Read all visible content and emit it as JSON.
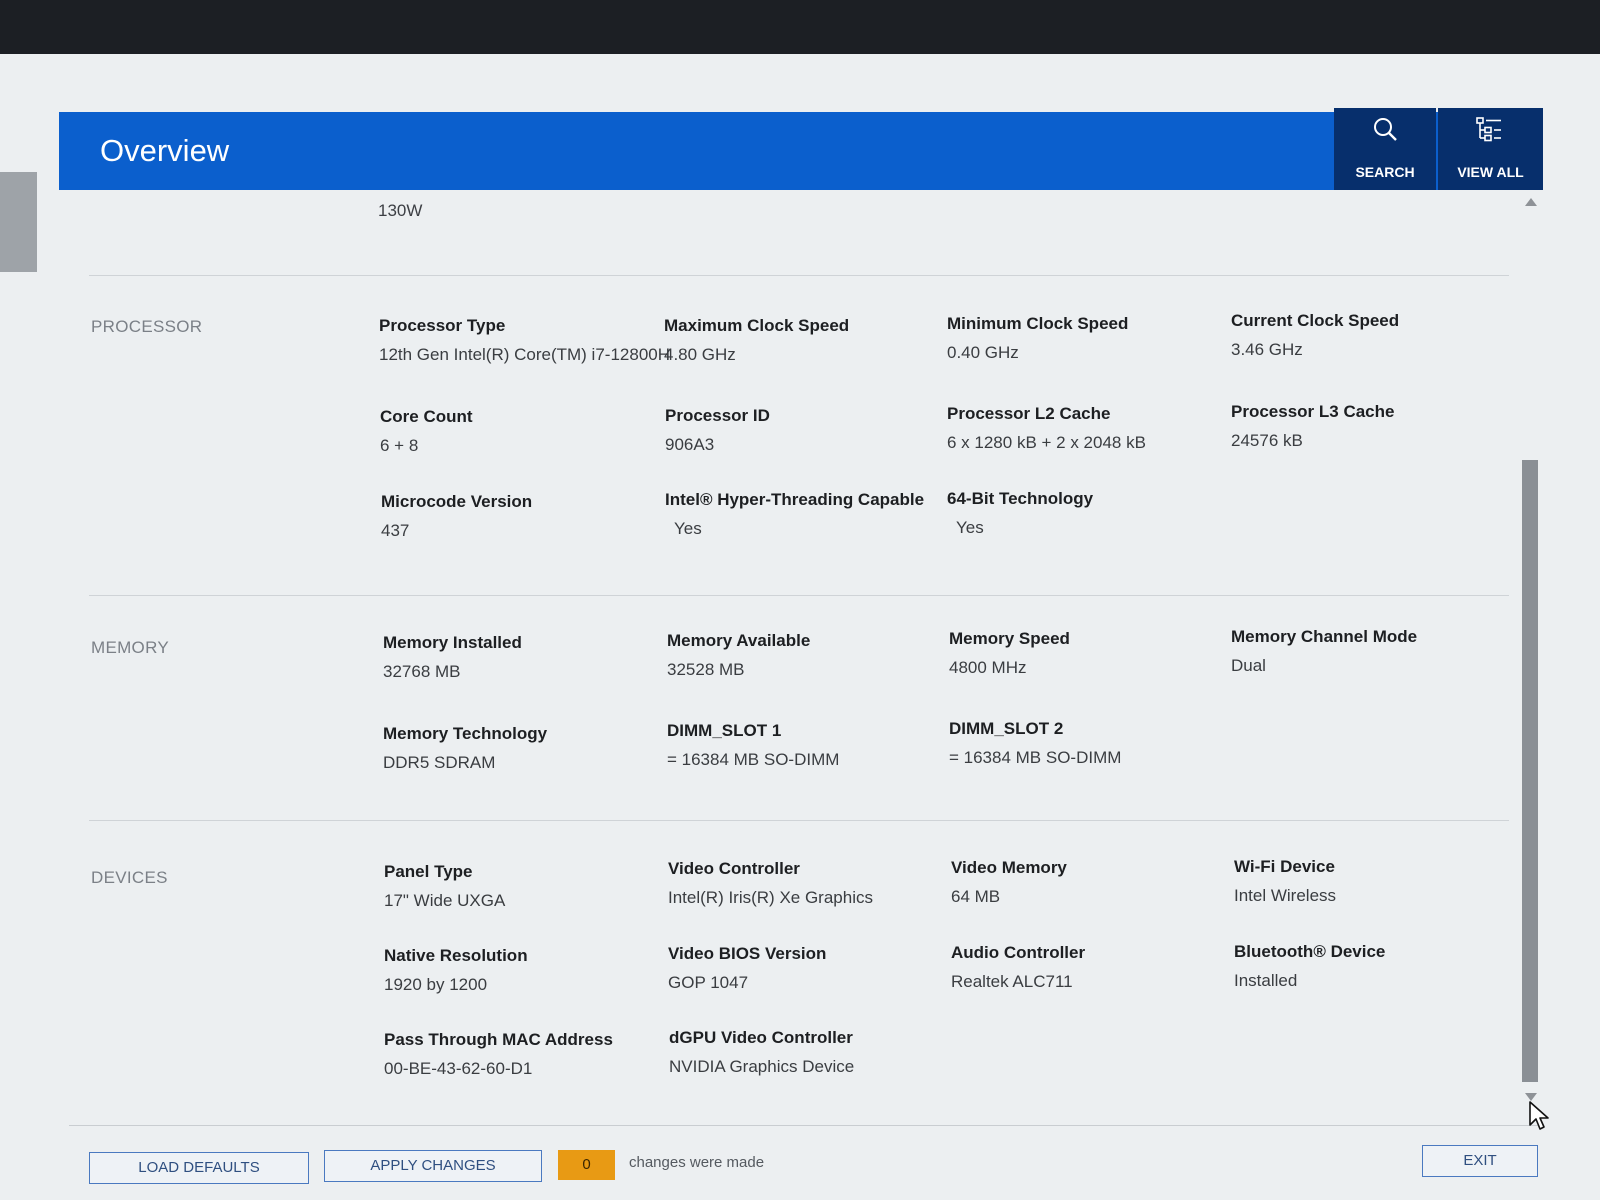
{
  "header": {
    "title": "Overview",
    "search_label": "SEARCH",
    "view_all_label": "VIEW ALL",
    "search_icon": "search-icon",
    "view_all_icon": "tree-list-icon"
  },
  "top_value": "130W",
  "sections": {
    "processor": {
      "label": "PROCESSOR",
      "fields": [
        {
          "label": "Processor Type",
          "value": "12th Gen Intel(R) Core(TM) i7-12800H"
        },
        {
          "label": "Maximum Clock Speed",
          "value": "4.80 GHz"
        },
        {
          "label": "Minimum Clock Speed",
          "value": "0.40 GHz"
        },
        {
          "label": "Current Clock Speed",
          "value": "3.46 GHz"
        },
        {
          "label": "Core Count",
          "value": "6 + 8"
        },
        {
          "label": "Processor ID",
          "value": "906A3"
        },
        {
          "label": "Processor L2 Cache",
          "value": "6 x 1280  kB + 2 x 2048  kB"
        },
        {
          "label": "Processor L3 Cache",
          "value": "24576 kB"
        },
        {
          "label": "Microcode Version",
          "value": "437"
        },
        {
          "label": "Intel® Hyper-Threading Capable",
          "value": "Yes"
        },
        {
          "label": "64-Bit Technology",
          "value": "Yes"
        }
      ]
    },
    "memory": {
      "label": "MEMORY",
      "fields": [
        {
          "label": "Memory Installed",
          "value": "32768 MB"
        },
        {
          "label": "Memory Available",
          "value": "32528 MB"
        },
        {
          "label": "Memory Speed",
          "value": "4800 MHz"
        },
        {
          "label": "Memory Channel Mode",
          "value": "Dual"
        },
        {
          "label": "Memory Technology",
          "value": "DDR5 SDRAM"
        },
        {
          "label": "DIMM_SLOT 1",
          "value": "= 16384 MB SO-DIMM"
        },
        {
          "label": "DIMM_SLOT 2",
          "value": "= 16384 MB SO-DIMM"
        }
      ]
    },
    "devices": {
      "label": "DEVICES",
      "fields": [
        {
          "label": "Panel Type",
          "value": "17\" Wide UXGA"
        },
        {
          "label": "Video Controller",
          "value": "Intel(R) Iris(R) Xe Graphics"
        },
        {
          "label": "Video Memory",
          "value": "64 MB"
        },
        {
          "label": "Wi-Fi Device",
          "value": "Intel Wireless"
        },
        {
          "label": "Native Resolution",
          "value": "1920 by 1200"
        },
        {
          "label": "Video BIOS Version",
          "value": "GOP 1047"
        },
        {
          "label": "Audio Controller",
          "value": "Realtek ALC711"
        },
        {
          "label": "Bluetooth® Device",
          "value": "Installed"
        },
        {
          "label": "Pass Through MAC Address",
          "value": "00-BE-43-62-60-D1"
        },
        {
          "label": "dGPU Video Controller",
          "value": "NVIDIA Graphics Device"
        }
      ]
    }
  },
  "footer": {
    "load_defaults": "LOAD DEFAULTS",
    "apply_changes": "APPLY CHANGES",
    "change_count": "0",
    "changes_text": "changes were made",
    "exit": "EXIT"
  },
  "colors": {
    "header_blue": "#0b5fcd",
    "header_button_navy": "#072f6c",
    "counter_orange": "#e89a14"
  }
}
